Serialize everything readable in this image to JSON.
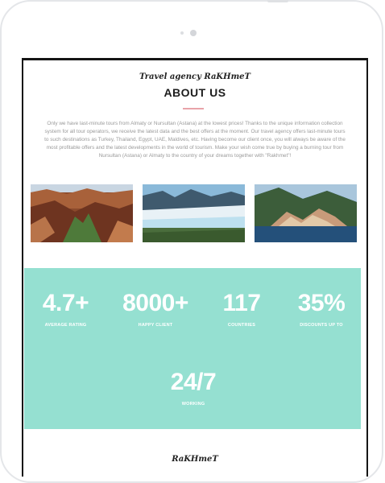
{
  "header": {
    "brand": "Travel agency RaKHmeT",
    "title": "ABOUT US",
    "description": "Only we have last-minute tours from Almaty or Nursultan (Astana) at the lowest prices! Thanks to the unique information collection system for all tour operators, we receive the latest data and the best offers at the moment. Our travel agency offers last-minute tours to such destinations as Turkey, Thailand, Egypt, UAE, Maldives, etc. Having become our client once, you will always be aware of the most profitable offers and the latest developments in the world of tourism. Make your wish come true by buying a burning tour from Nursultan (Astana) or Almaty to the country of your dreams together with \"Rakhmet\"!"
  },
  "gallery": {
    "photos": [
      {
        "subject": "canyon-landscape"
      },
      {
        "subject": "glacier-landscape"
      },
      {
        "subject": "coastal-town-landscape"
      }
    ]
  },
  "stats": [
    {
      "value": "4.7+",
      "label": "AVERAGE RATING"
    },
    {
      "value": "8000+",
      "label": "HAPPY CLIENT"
    },
    {
      "value": "117",
      "label": "COUNTRIES"
    },
    {
      "value": "35%",
      "label": "DISCOUNTS UP TO"
    },
    {
      "value": "24/7",
      "label": "WORKING"
    }
  ],
  "footer": {
    "brand": "RaKHmeT"
  },
  "colors": {
    "accent": "#95e0d1",
    "divider": "#e9a3a9",
    "bezel": "#151515"
  }
}
